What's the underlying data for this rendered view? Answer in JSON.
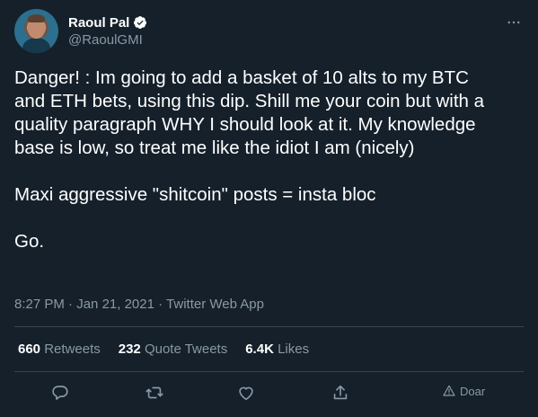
{
  "author": {
    "display_name": "Raoul Pal",
    "handle": "@RaoulGMI",
    "verified": true
  },
  "tweet": {
    "lines": [
      "Danger! : Im going to add a basket of 10 alts to my BTC",
      "and ETH bets, using this dip. Shill me your coin but with a",
      "quality paragraph WHY I should look at it. My knowledge",
      "base is low, so treat me like the idiot I am (nicely)",
      "",
      "Maxi aggressive \"shitcoin\" posts = insta bloc",
      "",
      "Go."
    ],
    "time": "8:27 PM",
    "date": "Jan 21, 2021",
    "source": "Twitter Web App"
  },
  "stats": {
    "retweets_count": "660",
    "retweets_label": "Retweets",
    "quotes_count": "232",
    "quotes_label": "Quote Tweets",
    "likes_count": "6.4K",
    "likes_label": "Likes"
  },
  "actions": {
    "share_label": "Doar"
  },
  "colors": {
    "background": "#15202b",
    "text": "#ffffff",
    "secondary": "#8899a6",
    "divider": "#38444d",
    "verified": "#ffffff"
  },
  "icons": [
    "verified-icon",
    "more-icon",
    "reply-icon",
    "retweet-icon",
    "like-icon",
    "share-icon",
    "dismiss-icon"
  ]
}
